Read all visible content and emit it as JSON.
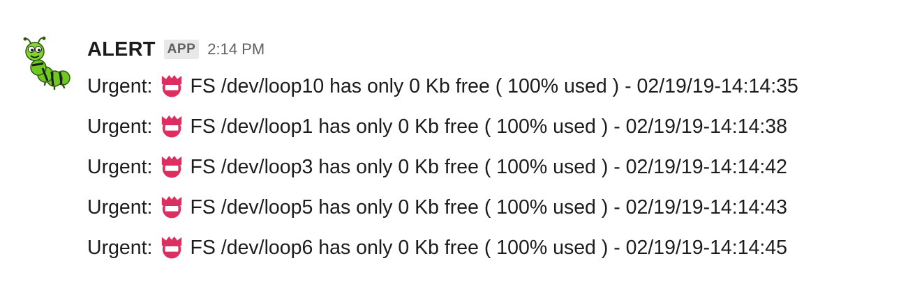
{
  "message": {
    "sender": "ALERT",
    "badge": "APP",
    "time": "2:14 PM",
    "avatar_icon": "caterpillar-icon",
    "emoji_icon": "name-badge-icon",
    "emoji_color": "#dd2e61",
    "lines": [
      {
        "prefix": "Urgent:",
        "text": "FS /dev/loop10 has only 0 Kb free ( 100% used ) - 02/19/19-14:14:35"
      },
      {
        "prefix": "Urgent:",
        "text": "FS /dev/loop1 has only 0 Kb free ( 100% used ) - 02/19/19-14:14:38"
      },
      {
        "prefix": "Urgent:",
        "text": "FS /dev/loop3 has only 0 Kb free ( 100% used ) - 02/19/19-14:14:42"
      },
      {
        "prefix": "Urgent:",
        "text": "FS /dev/loop5 has only 0 Kb free ( 100% used ) - 02/19/19-14:14:43"
      },
      {
        "prefix": "Urgent:",
        "text": "FS /dev/loop6 has only 0 Kb free ( 100% used ) - 02/19/19-14:14:45"
      }
    ]
  }
}
